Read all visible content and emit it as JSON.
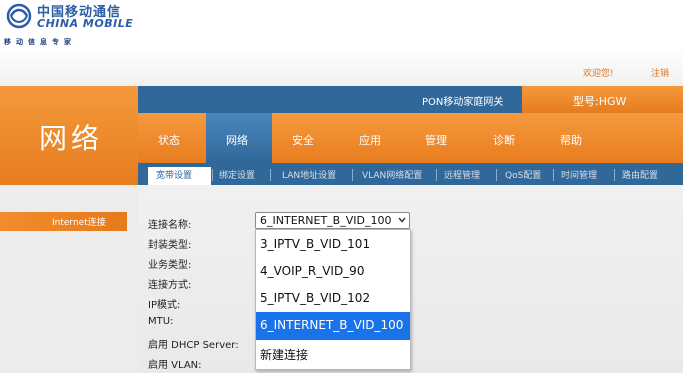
{
  "branding": {
    "name_cn": "中国移动通信",
    "name_en": "CHINA MOBILE",
    "slogan": "移动信息专家",
    "logo_color": "#2a5ea8"
  },
  "header": {
    "welcome": "欢迎您!",
    "logout": "注销",
    "device_title": "PON移动家庭网关",
    "model": "型号:HGW",
    "section_title": "网络"
  },
  "nav": {
    "items": [
      "状态",
      "网络",
      "安全",
      "应用",
      "管理",
      "诊断",
      "帮助"
    ],
    "active": "网络"
  },
  "subnav": {
    "items": [
      "宽带设置",
      "绑定设置",
      "LAN地址设置",
      "VLAN网络配置",
      "远程管理",
      "QoS配置",
      "时间管理",
      "路由配置"
    ],
    "active": "宽带设置"
  },
  "sidebar": {
    "active_item": "Internet连接"
  },
  "form": {
    "labels": [
      "连接名称:",
      "封装类型:",
      "业务类型:",
      "连接方式:",
      "IP模式:",
      "MTU:",
      "启用 DHCP Server:",
      "启用 VLAN:"
    ],
    "connection_name": {
      "value": "6_INTERNET_B_VID_100",
      "options": [
        "3_IPTV_B_VID_101",
        "4_VOIP_R_VID_90",
        "5_IPTV_B_VID_102",
        "6_INTERNET_B_VID_100",
        "新建连接"
      ],
      "highlighted": "6_INTERNET_B_VID_100"
    }
  },
  "colors": {
    "orange": "#e87d1f",
    "blue": "#31689a",
    "highlight": "#1a73e8"
  }
}
